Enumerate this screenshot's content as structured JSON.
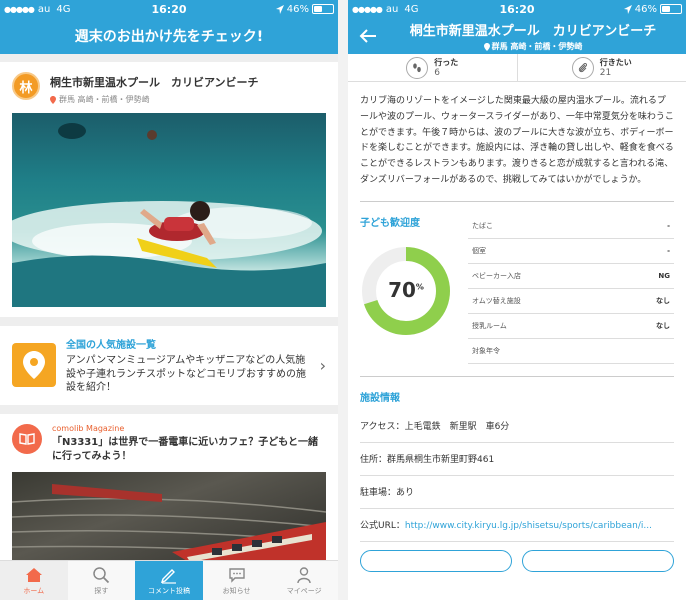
{
  "status": {
    "carrier": "au",
    "network": "4G",
    "time": "16:20",
    "battery": "46%",
    "battery_level": 0.46
  },
  "left": {
    "header_title": "週末のお出かけ先をチェック!",
    "place": {
      "avatar_text": "林",
      "name": "桐生市新里温水プール　カリビアンビーチ",
      "location": "群馬 高崎・前橋・伊勢崎"
    },
    "promo": {
      "title": "全国の人気施設一覧",
      "desc": "アンパンマンミュージアムやキッザニアなどの人気施設や子連れランチスポットなどコモリブおすすめの施設を紹介！"
    },
    "magazine": {
      "label": "comolib Magazine",
      "title": "「N3331」は世界で一番電車に近いカフェ？子どもと一緒に行ってみよう！"
    },
    "tabs": [
      {
        "label": "ホーム",
        "icon": "home-icon"
      },
      {
        "label": "探す",
        "icon": "search-icon"
      },
      {
        "label": "コメント投稿",
        "icon": "pencil-icon"
      },
      {
        "label": "お知らせ",
        "icon": "chat-icon"
      },
      {
        "label": "マイページ",
        "icon": "person-icon"
      }
    ]
  },
  "right": {
    "header_title": "桐生市新里温水プール　カリビアンビーチ",
    "header_sub": "群馬 高崎・前橋・伊勢崎",
    "stats": [
      {
        "label": "行った",
        "count": "6",
        "icon": "footprints-icon"
      },
      {
        "label": "行きたい",
        "count": "21",
        "icon": "paperclip-icon"
      }
    ],
    "description": "カリブ海のリゾートをイメージした関東最大級の屋内温水プール。流れるプールや波のプール、ウォータースライダーがあり、一年中常夏気分を味わうことができます。午後７時からは、波のプールに大きな波が立ち、ボディーボードを楽しむことができます。施設内には、浮き輪の貸し出しや、軽食を食べることができるレストランもあります。渡りきると恋が成就すると言われる滝、ダンズリバーフォールがあるので、挑戦してみてはいかがでしょうか。",
    "kid_title": "子ども歓迎度",
    "kid_value": "70",
    "kid_unit": "%",
    "kid_ratio": 0.7,
    "kid_rows": [
      {
        "label": "たばこ",
        "value": "-"
      },
      {
        "label": "個室",
        "value": "-"
      },
      {
        "label": "ベビーカー入店",
        "value": "NG"
      },
      {
        "label": "オムツ替え施設",
        "value": "なし"
      },
      {
        "label": "授乳ルーム",
        "value": "なし"
      },
      {
        "label": "対象年令",
        "value": ""
      }
    ],
    "info_title": "施設情報",
    "info_rows": [
      {
        "label": "アクセス：",
        "value": "上毛電鉄　新里駅　車6分"
      },
      {
        "label": "住所：",
        "value": "群馬県桐生市新里町野461"
      },
      {
        "label": "駐車場：",
        "value": "あり"
      },
      {
        "label": "公式URL：",
        "value": "http://www.city.kiryu.lg.jp/shisetsu/sports/caribbean/i..."
      }
    ]
  },
  "colors": {
    "primary": "#2fa3d8",
    "accent_orange": "#f5a623",
    "accent_red": "#f26a4b",
    "donut_green": "#8fcf4c"
  }
}
